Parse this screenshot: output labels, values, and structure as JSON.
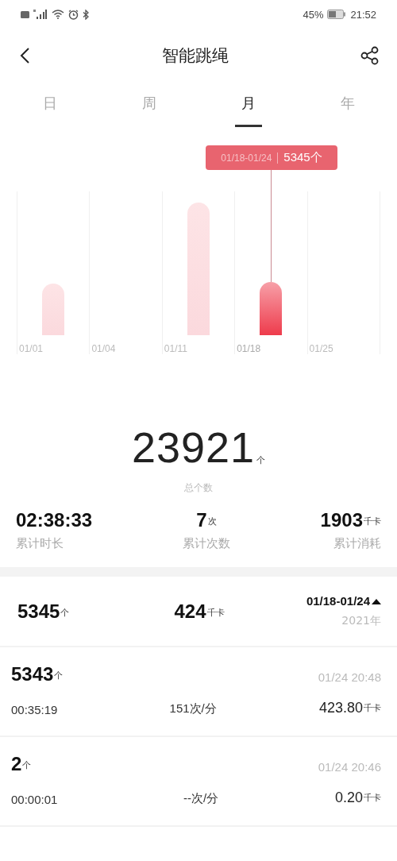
{
  "status_bar": {
    "battery_text": "45%",
    "time": "21:52"
  },
  "header": {
    "title": "智能跳绳"
  },
  "tabs": [
    {
      "label": "日",
      "selected": false
    },
    {
      "label": "周",
      "selected": false
    },
    {
      "label": "月",
      "selected": true
    },
    {
      "label": "年",
      "selected": false
    }
  ],
  "chart": {
    "columns": [
      {
        "label": "01/01",
        "selected": false
      },
      {
        "label": "01/04",
        "selected": false
      },
      {
        "label": "01/11",
        "selected": false
      },
      {
        "label": "01/18",
        "selected": true
      },
      {
        "label": "01/25",
        "selected": false
      }
    ],
    "tooltip": {
      "range": "01/18-01/24",
      "count": "5345个"
    }
  },
  "total": {
    "value": "23921",
    "unit": "个",
    "label": "总个数"
  },
  "stats": [
    {
      "value": "02:38:33",
      "label": "累计时长"
    },
    {
      "value": "7",
      "unit": "次",
      "label": "累计次数"
    },
    {
      "value": "1903",
      "unit": "千卡",
      "label": "累计消耗"
    }
  ],
  "summary": {
    "count": "5345",
    "count_unit": "个",
    "calories": "424",
    "calories_unit": "千卡",
    "range": "01/18-01/24",
    "year": "2021年",
    "expanded": true
  },
  "records": [
    {
      "count": "5343",
      "unit": "个",
      "time": "01/24 20:48",
      "duration": "00:35:19",
      "rate": "151次/分",
      "calories": "423.80",
      "calories_unit": "千卡"
    },
    {
      "count": "2",
      "unit": "个",
      "time": "01/24 20:46",
      "duration": "00:00:01",
      "rate": "--次/分",
      "calories": "0.20",
      "calories_unit": "千卡"
    }
  ]
}
